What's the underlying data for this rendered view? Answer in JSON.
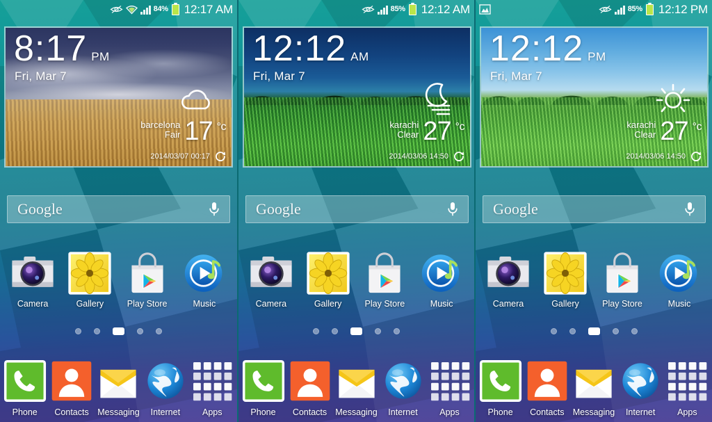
{
  "device": "Samsung Galaxy S5 TouchWiz home screen",
  "panels": [
    {
      "id": "panel-1",
      "statusbar": {
        "notification_icons": [],
        "icons": [
          "eye-icon",
          "wifi-icon",
          "signal-icon"
        ],
        "battery_percent": "84%",
        "clock": "12:17 AM"
      },
      "widget": {
        "scene": "wheat-field-storm",
        "time": "8:17",
        "ampm": "PM",
        "date": "Fri, Mar 7",
        "weather_icon": "cloud-icon",
        "city": "barcelona",
        "condition": "Fair",
        "temperature": "17",
        "unit": "°c",
        "updated": "2014/03/07 00:17",
        "refresh_icon": "refresh-icon"
      },
      "search": {
        "label": "Google",
        "mic_icon": "microphone-icon"
      },
      "apps": [
        {
          "label": "Camera",
          "icon": "camera-icon"
        },
        {
          "label": "Gallery",
          "icon": "gallery-icon"
        },
        {
          "label": "Play Store",
          "icon": "play-store-icon"
        },
        {
          "label": "Music",
          "icon": "music-icon"
        }
      ],
      "page_dots": {
        "count": 5,
        "active_index": 2,
        "active_shape": "home"
      },
      "dock": [
        {
          "label": "Phone",
          "icon": "phone-icon"
        },
        {
          "label": "Contacts",
          "icon": "contacts-icon"
        },
        {
          "label": "Messaging",
          "icon": "messaging-icon"
        },
        {
          "label": "Internet",
          "icon": "internet-icon"
        },
        {
          "label": "Apps",
          "icon": "apps-grid-icon"
        }
      ]
    },
    {
      "id": "panel-2",
      "statusbar": {
        "notification_icons": [],
        "icons": [
          "eye-icon",
          "signal-icon"
        ],
        "battery_percent": "85%",
        "clock": "12:12 AM"
      },
      "widget": {
        "scene": "grass-field-night",
        "time": "12:12",
        "ampm": "AM",
        "date": "Fri, Mar 7",
        "weather_icon": "moon-haze-icon",
        "city": "karachi",
        "condition": "Clear",
        "temperature": "27",
        "unit": "°c",
        "updated": "2014/03/06 14:50",
        "refresh_icon": "refresh-icon"
      },
      "search": {
        "label": "Google",
        "mic_icon": "microphone-icon"
      },
      "apps": [
        {
          "label": "Camera",
          "icon": "camera-icon"
        },
        {
          "label": "Gallery",
          "icon": "gallery-icon"
        },
        {
          "label": "Play Store",
          "icon": "play-store-icon"
        },
        {
          "label": "Music",
          "icon": "music-icon"
        }
      ],
      "page_dots": {
        "count": 5,
        "active_index": 2,
        "active_shape": "home"
      },
      "dock": [
        {
          "label": "Phone",
          "icon": "phone-icon"
        },
        {
          "label": "Contacts",
          "icon": "contacts-icon"
        },
        {
          "label": "Messaging",
          "icon": "messaging-icon"
        },
        {
          "label": "Internet",
          "icon": "internet-icon"
        },
        {
          "label": "Apps",
          "icon": "apps-grid-icon"
        }
      ]
    },
    {
      "id": "panel-3",
      "statusbar": {
        "notification_icons": [
          "screenshot-image-icon"
        ],
        "icons": [
          "eye-icon",
          "signal-icon"
        ],
        "battery_percent": "85%",
        "clock": "12:12 PM"
      },
      "widget": {
        "scene": "grass-field-day",
        "time": "12:12",
        "ampm": "PM",
        "date": "Fri, Mar 7",
        "weather_icon": "sun-icon",
        "city": "karachi",
        "condition": "Clear",
        "temperature": "27",
        "unit": "°c",
        "updated": "2014/03/06 14:50",
        "refresh_icon": "refresh-icon"
      },
      "search": {
        "label": "Google",
        "mic_icon": "microphone-icon"
      },
      "apps": [
        {
          "label": "Camera",
          "icon": "camera-icon"
        },
        {
          "label": "Gallery",
          "icon": "gallery-icon"
        },
        {
          "label": "Play Store",
          "icon": "play-store-icon"
        },
        {
          "label": "Music",
          "icon": "music-icon"
        }
      ],
      "page_dots": {
        "count": 5,
        "active_index": 2,
        "active_shape": "home"
      },
      "dock": [
        {
          "label": "Phone",
          "icon": "phone-icon"
        },
        {
          "label": "Contacts",
          "icon": "contacts-icon"
        },
        {
          "label": "Messaging",
          "icon": "messaging-icon"
        },
        {
          "label": "Internet",
          "icon": "internet-icon"
        },
        {
          "label": "Apps",
          "icon": "apps-grid-icon"
        }
      ]
    }
  ],
  "colors": {
    "wallpaper_top": "#15a098",
    "wallpaper_bottom": "#4a3f96",
    "battery_fill": "#b9e54a",
    "status_text": "#ffffff",
    "phone_green": "#5fbb2c",
    "contacts_orange": "#f4602c",
    "messaging_yellow": "#f5c518",
    "internet_blue": "#1e8ed6",
    "music_blue": "#1a7fd4"
  }
}
